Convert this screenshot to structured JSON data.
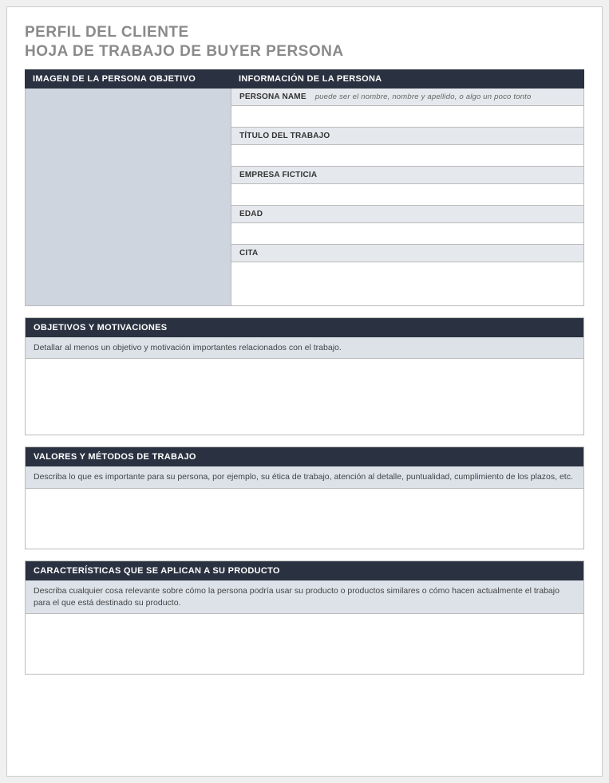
{
  "title": {
    "line1": "PERFIL DEL CLIENTE",
    "line2": "HOJA DE TRABAJO DE BUYER PERSONA"
  },
  "topSection": {
    "imageHeader": "IMAGEN DE LA PERSONA OBJETIVO",
    "infoHeader": "INFORMACIÓN DE LA PERSONA",
    "fields": {
      "personaName": {
        "label": "PERSONA NAME",
        "hint": "puede ser el nombre, nombre y apellido, o algo un poco tonto"
      },
      "jobTitle": {
        "label": "TÍTULO DEL TRABAJO"
      },
      "company": {
        "label": "EMPRESA FICTICIA"
      },
      "age": {
        "label": "EDAD"
      },
      "quote": {
        "label": "CITA"
      }
    }
  },
  "sections": {
    "objectives": {
      "header": "OBJETIVOS Y MOTIVACIONES",
      "description": "Detallar al menos un objetivo y motivación importantes relacionados con el trabajo."
    },
    "values": {
      "header": "VALORES Y MÉTODOS DE TRABAJO",
      "description": "Describa lo que es importante para su persona, por ejemplo, su ética de trabajo, atención al detalle, puntualidad, cumplimiento de los plazos, etc."
    },
    "characteristics": {
      "header": "CARACTERÍSTICAS QUE SE APLICAN A SU PRODUCTO",
      "description": "Describa cualquier cosa relevante sobre cómo la persona podría usar su producto o productos similares o cómo hacen actualmente el trabajo para el que está destinado su producto."
    }
  }
}
